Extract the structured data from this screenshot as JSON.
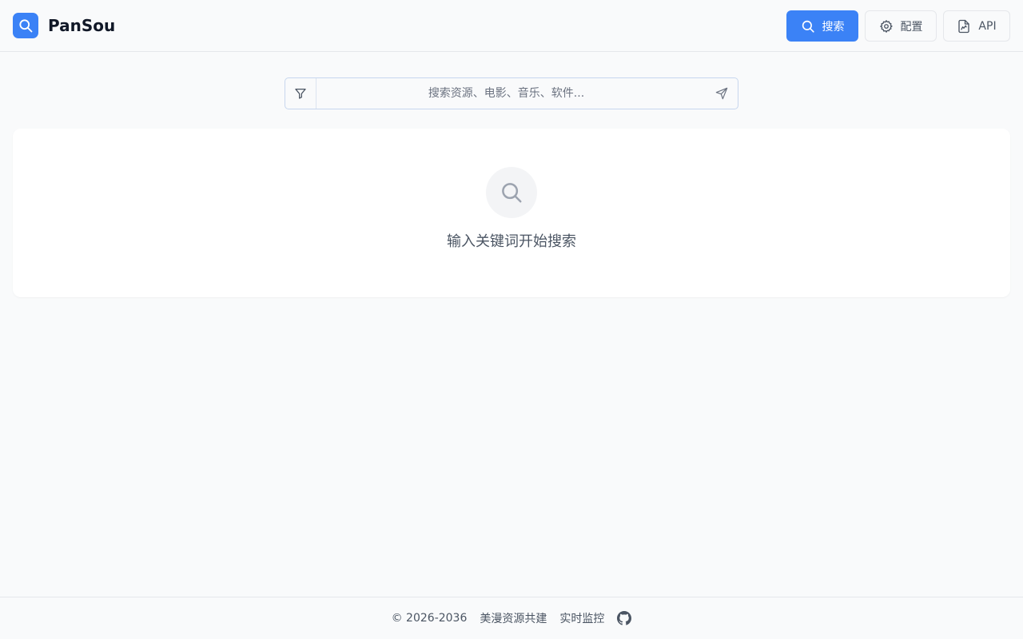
{
  "header": {
    "brand": "PanSou",
    "logo_icon": "search-icon",
    "buttons": {
      "search": {
        "label": "搜索",
        "icon": "search-icon"
      },
      "config": {
        "label": "配置",
        "icon": "gear-icon"
      },
      "api": {
        "label": "API",
        "icon": "file-chart-icon"
      }
    }
  },
  "search": {
    "placeholder": "搜索资源、电影、音乐、软件...",
    "filter_icon": "filter-icon",
    "send_icon": "send-icon"
  },
  "empty_state": {
    "icon": "search-icon",
    "message": "输入关键词开始搜索"
  },
  "footer": {
    "copyright": "© 2026-2036",
    "links": [
      "美漫资源共建",
      "实时监控"
    ],
    "github_icon": "github-icon"
  },
  "colors": {
    "accent": "#3b82f6",
    "background": "#f9fafb",
    "card": "#ffffff",
    "border": "#e5e7eb"
  }
}
